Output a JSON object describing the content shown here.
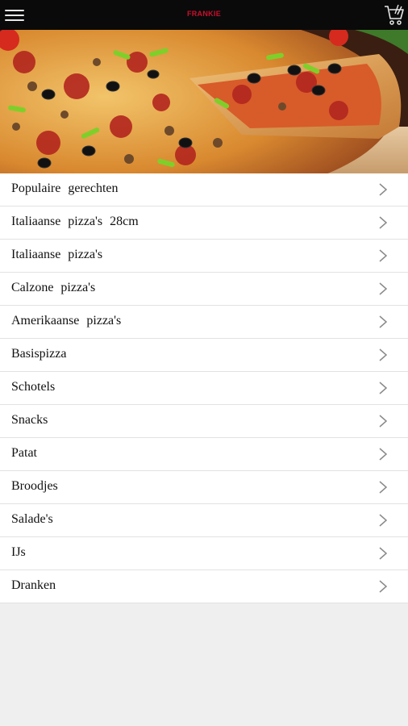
{
  "header": {
    "brand": "FRANKIE",
    "menu_icon": "hamburger-menu-icon",
    "cart_icon": "shopping-cart-icon",
    "background_color": "#0a0a0a",
    "brand_color": "#c8102e"
  },
  "hero": {
    "image": "pizza-photo"
  },
  "categories": [
    {
      "label": "Populaire gerechten"
    },
    {
      "label": "Italiaanse pizza's 28cm"
    },
    {
      "label": "Italiaanse pizza's"
    },
    {
      "label": "Calzone pizza's"
    },
    {
      "label": "Amerikaanse pizza's"
    },
    {
      "label": "Basispizza"
    },
    {
      "label": "Schotels"
    },
    {
      "label": "Snacks"
    },
    {
      "label": "Patat"
    },
    {
      "label": "Broodjes"
    },
    {
      "label": "Salade's"
    },
    {
      "label": "IJs"
    },
    {
      "label": "Dranken"
    }
  ],
  "row_icon": "chevron-right-icon"
}
